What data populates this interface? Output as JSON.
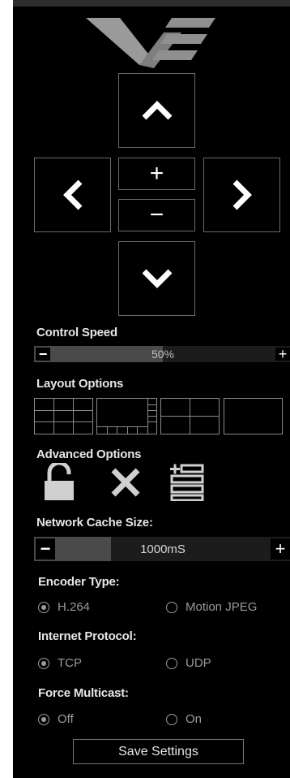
{
  "dpad": {
    "zoom_in": "+",
    "zoom_out": "−"
  },
  "control_speed": {
    "label": "Control Speed",
    "value": "50%",
    "level": 0.5,
    "minus": "−",
    "plus": "+"
  },
  "layout_options": {
    "label": "Layout Options",
    "icons": [
      "layout-grid-3x3-icon",
      "layout-main-plus-strip-icon",
      "layout-quad-icon",
      "layout-single-icon"
    ]
  },
  "advanced_options": {
    "label": "Advanced Options",
    "icons": [
      "unlock-icon",
      "close-icon",
      "add-list-icon"
    ]
  },
  "network_cache": {
    "label": "Network Cache Size:",
    "value": "1000mS",
    "level": 0.3,
    "minus": "−",
    "plus": "+"
  },
  "encoder_type": {
    "label": "Encoder Type:",
    "options": [
      "H.264",
      "Motion JPEG"
    ],
    "selected": "H.264"
  },
  "internet_protocol": {
    "label": "Internet Protocol:",
    "options": [
      "TCP",
      "UDP"
    ],
    "selected": "TCP"
  },
  "force_multicast": {
    "label": "Force Multicast:",
    "options": [
      "Off",
      "On"
    ],
    "selected": "Off"
  },
  "save_label": "Save Settings",
  "colors": {
    "panel": "#000000",
    "border": "#6b6b6b",
    "text": "#e6e6e6",
    "muted": "#9a9a9a"
  }
}
